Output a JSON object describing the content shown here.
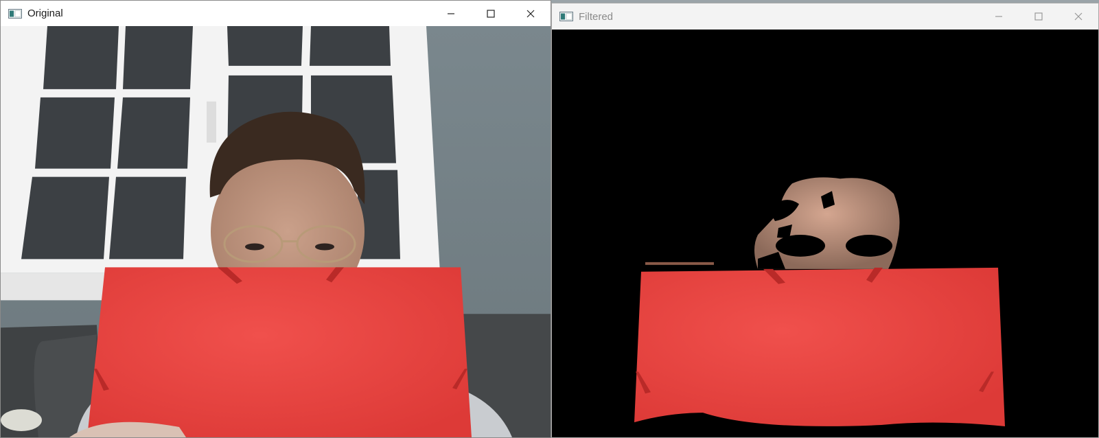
{
  "windows": {
    "original": {
      "title": "Original",
      "icon": "camera-window-icon",
      "controls": [
        "minimize-icon",
        "maximize-icon",
        "close-icon"
      ]
    },
    "filtered": {
      "title": "Filtered",
      "icon": "camera-window-icon",
      "controls": [
        "minimize-icon",
        "maximize-icon",
        "close-icon"
      ]
    }
  },
  "colors": {
    "folder_red": "#e8413f",
    "filtered_background": "#000000",
    "wall": "#77858c",
    "window_frame": "#f2f2f2",
    "window_glass": "#3a3e42",
    "sofa": "#46494b",
    "skin": "#c79a84",
    "hair": "#3a2a20"
  }
}
